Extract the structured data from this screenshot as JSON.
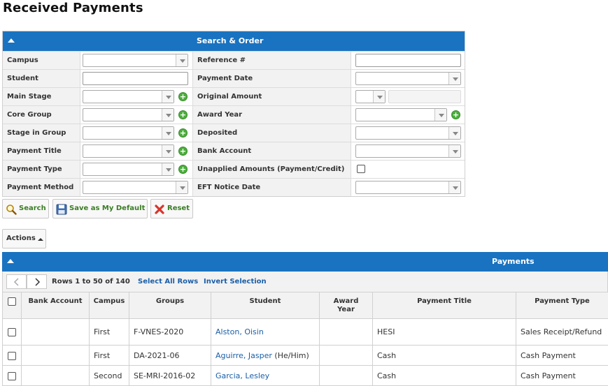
{
  "page": {
    "title": "Received Payments"
  },
  "search_panel": {
    "title": "Search & Order",
    "fields_left": [
      {
        "label": "Campus",
        "type": "select",
        "value": ""
      },
      {
        "label": "Student",
        "type": "text",
        "value": ""
      },
      {
        "label": "Main Stage",
        "type": "select-add",
        "value": ""
      },
      {
        "label": "Core Group",
        "type": "select-add",
        "value": ""
      },
      {
        "label": "Stage in Group",
        "type": "select-add",
        "value": ""
      },
      {
        "label": "Payment Title",
        "type": "select-add",
        "value": ""
      },
      {
        "label": "Payment Type",
        "type": "select-add",
        "value": ""
      },
      {
        "label": "Payment Method",
        "type": "select",
        "value": ""
      }
    ],
    "fields_right": [
      {
        "label": "Reference #",
        "type": "text",
        "value": ""
      },
      {
        "label": "Payment Date",
        "type": "select",
        "value": ""
      },
      {
        "label": "Original Amount",
        "type": "operator-amount",
        "value": ""
      },
      {
        "label": "Award Year",
        "type": "select-add",
        "value": ""
      },
      {
        "label": "Deposited",
        "type": "select",
        "value": ""
      },
      {
        "label": "Bank Account",
        "type": "select",
        "value": ""
      },
      {
        "label": "Unapplied Amounts (Payment/Credit)",
        "type": "checkbox",
        "checked": false
      },
      {
        "label": "EFT Notice Date",
        "type": "select",
        "value": ""
      }
    ]
  },
  "buttons": {
    "search": "Search",
    "save_default": "Save as My Default",
    "reset": "Reset",
    "actions": "Actions"
  },
  "payments": {
    "title": "Payments",
    "pager_text": "Rows 1 to 50 of 140",
    "select_all": "Select All Rows",
    "invert_selection": "Invert Selection",
    "columns": [
      "Bank Account",
      "Campus",
      "Groups",
      "Student",
      "Award Year",
      "Payment Title",
      "Payment Type"
    ],
    "rows": [
      {
        "bank_account": "",
        "campus": "First",
        "groups": "F-VNES-2020",
        "student": "Alston, Oisin",
        "pronoun": "",
        "award_year": "",
        "payment_title": "HESI",
        "payment_type": "Sales Receipt/Refund"
      },
      {
        "bank_account": "",
        "campus": "First",
        "groups": "DA-2021-06",
        "student": "Aguirre, Jasper",
        "pronoun": "(He/Him)",
        "award_year": "",
        "payment_title": "Cash",
        "payment_type": "Cash Payment"
      },
      {
        "bank_account": "",
        "campus": "Second",
        "groups": "SE-MRI-2016-02",
        "student": "Garcia, Lesley",
        "pronoun": "",
        "award_year": "",
        "payment_title": "Cash",
        "payment_type": "Cash Payment"
      }
    ]
  },
  "colors": {
    "header_blue": "#1a73c0",
    "link_blue": "#1a5fa8",
    "button_green_text": "#3a7d25",
    "add_icon_green": "#4caf3c",
    "reset_icon_red": "#d9342b"
  }
}
